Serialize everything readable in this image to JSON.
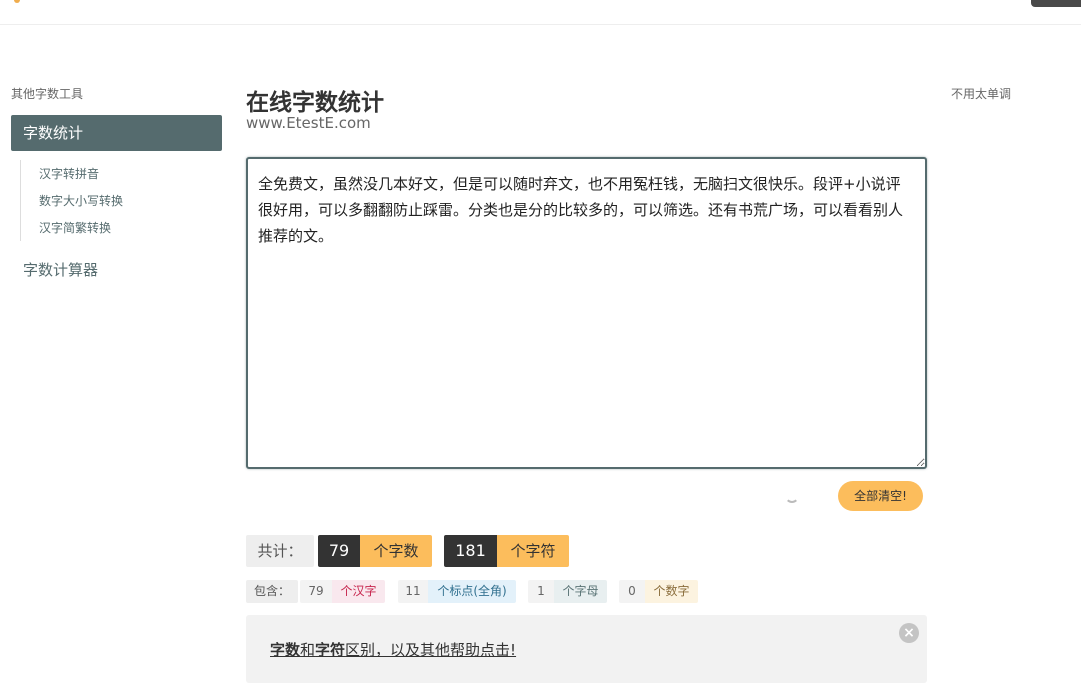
{
  "sidebar": {
    "title": "其他字数工具",
    "active_item": "字数统计",
    "sub_items": [
      "汉字转拼音",
      "数字大小写转换",
      "汉字简繁转换"
    ],
    "calculator": "字数计算器"
  },
  "header": {
    "title": "在线字数统计",
    "url": "www.EtestE.com",
    "right_note": "不用太单调"
  },
  "editor": {
    "text": "全免费文，虽然没几本好文，但是可以随时弃文，也不用冤枉钱，无脑扫文很快乐。段评+小说评很好用，可以多翻翻防止踩雷。分类也是分的比较多的，可以筛选。还有书荒广场，可以看看别人推荐的文。"
  },
  "clear_button": "全部清空!",
  "stats": {
    "total_label": "共计：",
    "words": {
      "value": "79",
      "label": "个字数"
    },
    "chars": {
      "value": "181",
      "label": "个字符"
    }
  },
  "breakdown": {
    "label": "包含：",
    "items": [
      {
        "value": "79",
        "label": "个汉字",
        "color": "#c7254e",
        "bg": "#f9e8ee"
      },
      {
        "value": "11",
        "label": "个标点(全角)",
        "color": "#31708f",
        "bg": "#e3f1fa"
      },
      {
        "value": "1",
        "label": "个字母",
        "color": "#5a7476",
        "bg": "#e8eff0"
      },
      {
        "value": "0",
        "label": "个数字",
        "color": "#8a6d3b",
        "bg": "#fcf3e0"
      }
    ]
  },
  "help": {
    "part1": "字数",
    "part2": "和",
    "part3": "字符",
    "part4": "区别，以及其他帮助点击!"
  },
  "colors": {
    "accent": "#556b6e",
    "orange": "#fcbd5c",
    "dark": "#333333"
  }
}
